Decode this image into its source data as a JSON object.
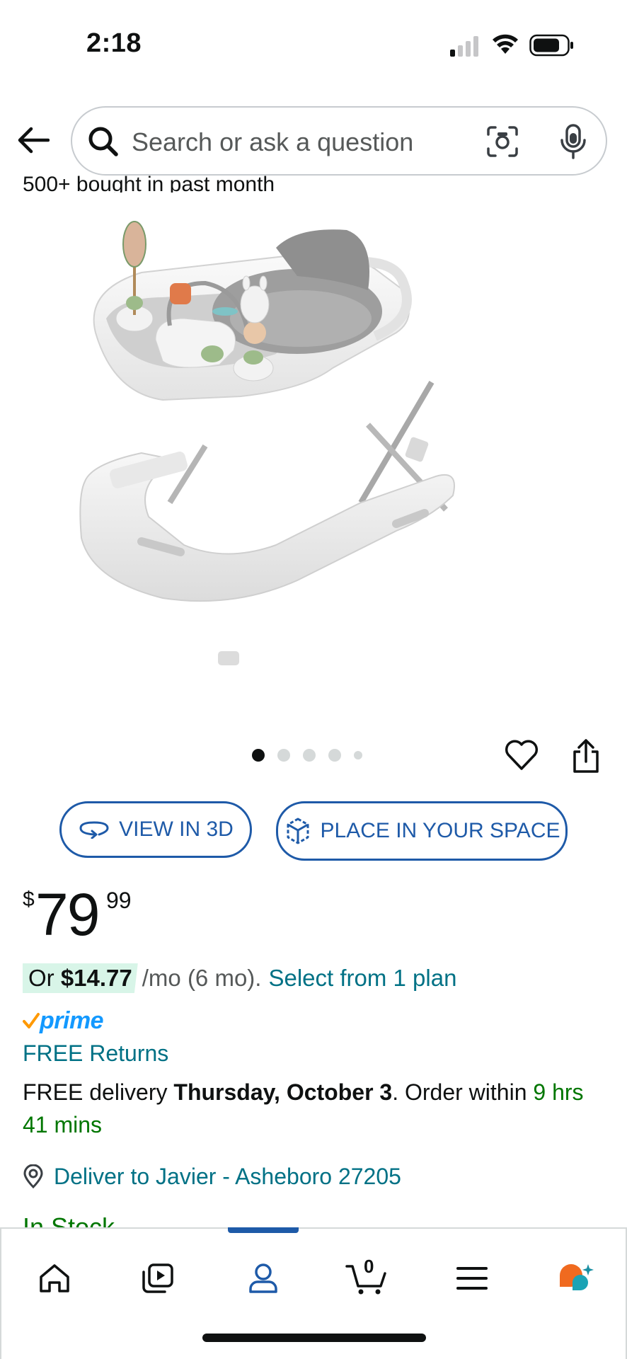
{
  "status_bar": {
    "time": "2:18"
  },
  "search": {
    "placeholder": "Search or ask a question"
  },
  "product": {
    "social_proof": "500+ bought in past month",
    "image_alt": "baby walker",
    "carousel": {
      "total": 5,
      "active_index": 0
    }
  },
  "actions": {
    "view_3d_label": "VIEW IN 3D",
    "place_in_space_label": "PLACE IN YOUR SPACE"
  },
  "price": {
    "symbol": "$",
    "whole": "79",
    "fraction": "99"
  },
  "installment": {
    "prefix": "Or ",
    "amount": "$14.77",
    "term": " /mo (6 mo).",
    "link": "Select from 1 plan"
  },
  "prime": {
    "check": "✓",
    "label": "prime"
  },
  "returns": {
    "label": "FREE Returns"
  },
  "delivery": {
    "prefix": "FREE delivery ",
    "date": "Thursday, October 3",
    "middle": ". Order within ",
    "countdown": "9 hrs 41 mins"
  },
  "deliver_to": {
    "label": "Deliver to Javier - Asheboro 27205"
  },
  "stock": {
    "label": "In Stock"
  },
  "tab_bar": {
    "cart_count": "0",
    "active_tab": "account"
  },
  "colors": {
    "link": "#007185",
    "accent_blue": "#1e5aa8",
    "prime_blue": "#1399ff",
    "green": "#007600",
    "installment_bg": "#d8f5e8",
    "prime_check": "#ff9900"
  }
}
